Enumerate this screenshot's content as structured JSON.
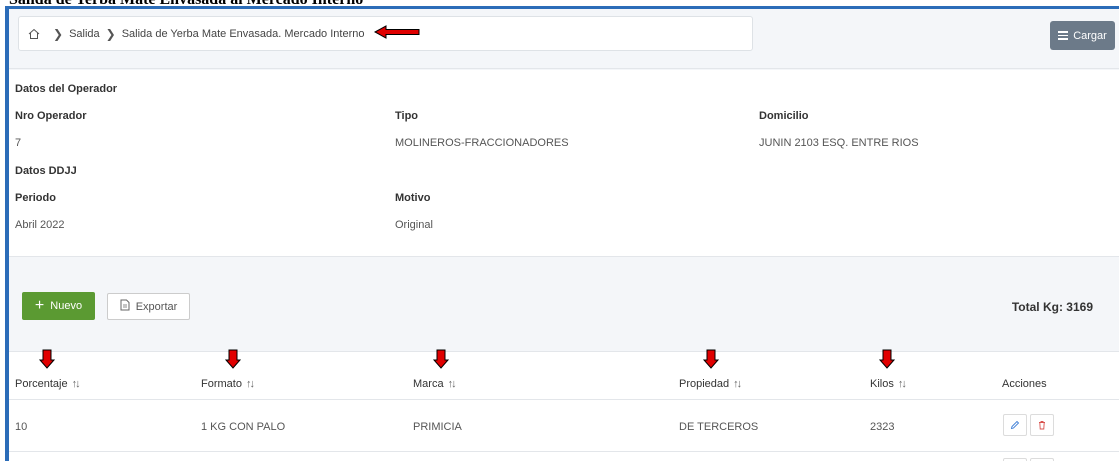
{
  "document_title": "Salida de Yerba Mate Envasada al Mercado Interno",
  "breadcrumb": {
    "items": [
      "Salida",
      "Salida de Yerba Mate Envasada. Mercado Interno"
    ]
  },
  "header": {
    "cargar_label": "Cargar"
  },
  "operador": {
    "section_title": "Datos del Operador",
    "nro_label": "Nro Operador",
    "nro_value": "7",
    "tipo_label": "Tipo",
    "tipo_value": "MOLINEROS-FRACCIONADORES",
    "domicilio_label": "Domicilio",
    "domicilio_value": "JUNIN 2103 ESQ. ENTRE RIOS"
  },
  "ddjj": {
    "section_title": "Datos DDJJ",
    "periodo_label": "Periodo",
    "periodo_value": "Abril 2022",
    "motivo_label": "Motivo",
    "motivo_value": "Original"
  },
  "actions": {
    "nuevo_label": "Nuevo",
    "exportar_label": "Exportar",
    "total_label": "Total Kg: 3169"
  },
  "table": {
    "columns": [
      "Porcentaje",
      "Formato",
      "Marca",
      "Propiedad",
      "Kilos",
      "Acciones"
    ],
    "rows": [
      [
        "10",
        "1 KG CON PALO",
        "PRIMICIA",
        "DE TERCEROS",
        "2323"
      ]
    ]
  },
  "colors": {
    "frame_border": "#2b6cb8",
    "nuevo_button": "#5b9a32",
    "cargar_button": "#6c7a89",
    "annotation_arrow": "#e00000",
    "edit_icon": "#3a7bd5",
    "delete_icon": "#d9534f"
  },
  "icons": {
    "breadcrumb_home": "home-icon",
    "cargar": "menu-icon",
    "nuevo": "plus-icon",
    "exportar": "file-export-icon",
    "sort": "sort-icon",
    "edit": "pencil-icon",
    "delete": "trash-icon"
  }
}
